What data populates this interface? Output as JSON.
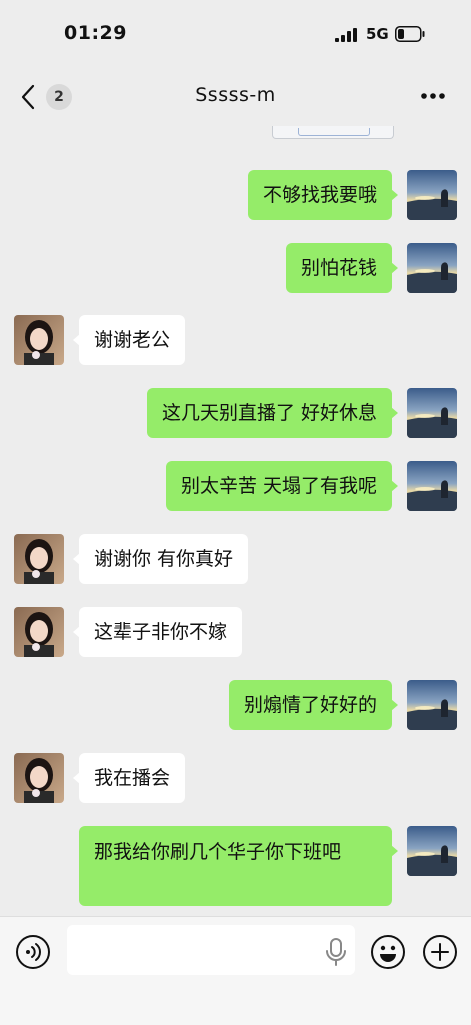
{
  "status_bar": {
    "time": "01:29",
    "network": "5G",
    "icons": [
      "signal-icon",
      "battery-icon"
    ]
  },
  "header": {
    "back_icon": "chevron-left-icon",
    "unread_count": "2",
    "title": "Sssss-m",
    "more_icon": "more-dots-icon"
  },
  "messages": [
    {
      "sender": "me",
      "text": "不够找我要哦"
    },
    {
      "sender": "me",
      "text": "别怕花钱"
    },
    {
      "sender": "other",
      "text": "谢谢老公"
    },
    {
      "sender": "me",
      "text": "这几天别直播了 好好休息"
    },
    {
      "sender": "me",
      "text": "别太辛苦 天塌了有我呢"
    },
    {
      "sender": "other",
      "text": "谢谢你 有你真好"
    },
    {
      "sender": "other",
      "text": "这辈子非你不嫁"
    },
    {
      "sender": "me",
      "text": "别煽情了好好的"
    },
    {
      "sender": "other",
      "text": "我在播会"
    },
    {
      "sender": "me",
      "text": "那我给你刷几个华子你下班吧"
    }
  ],
  "input_bar": {
    "placeholder": "",
    "icons": [
      "voice-icon",
      "microphone-icon",
      "emoji-icon",
      "plus-icon"
    ]
  },
  "colors": {
    "background": "#ededed",
    "my_bubble": "#95ec69",
    "their_bubble": "#ffffff"
  }
}
